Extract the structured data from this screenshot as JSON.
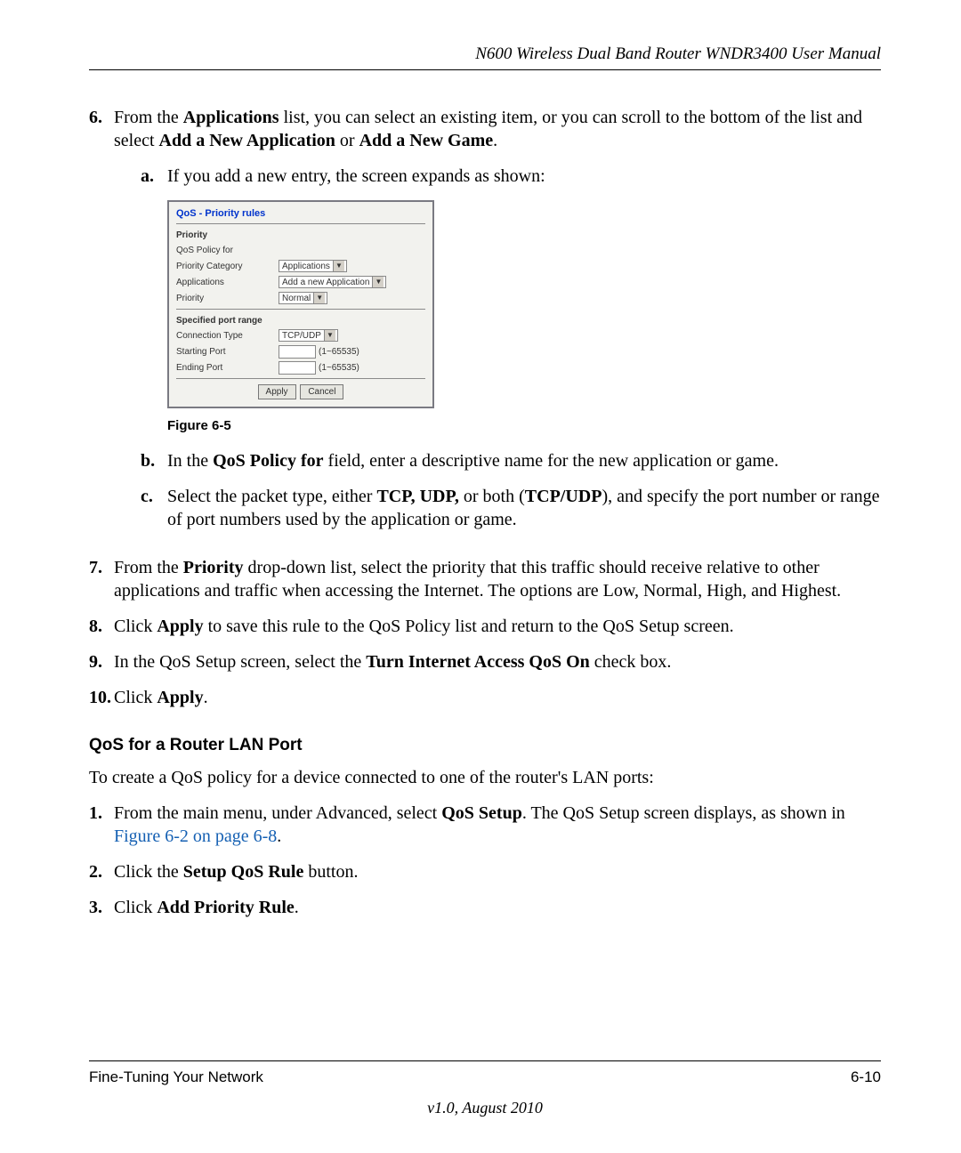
{
  "header": {
    "title": "N600 Wireless Dual Band Router WNDR3400 User Manual"
  },
  "steps": {
    "s6": {
      "num": "6.",
      "t1": "From the ",
      "b1": "Applications",
      "t2": " list, you can select an existing item, or you can scroll to the bottom of the list and select ",
      "b2": "Add a New Application",
      "t3": " or ",
      "b3": "Add a New Game",
      "t4": "."
    },
    "s6a": {
      "num": "a.",
      "text": "If you add a new entry, the screen expands as shown:"
    },
    "s6b": {
      "num": "b.",
      "t1": "In the ",
      "b1": "QoS Policy for",
      "t2": " field, enter a descriptive name for the new application or game."
    },
    "s6c": {
      "num": "c.",
      "t1": "Select the packet type, either ",
      "b1": "TCP, UDP,",
      "t2": " or both (",
      "b2": "TCP/UDP",
      "t3": "), and specify the port number or range of port numbers used by the application or game."
    },
    "s7": {
      "num": "7.",
      "t1": "From the ",
      "b1": "Priority",
      "t2": " drop-down list, select the priority that this traffic should receive relative to other applications and traffic when accessing the Internet. The options are Low, Normal, High, and Highest."
    },
    "s8": {
      "num": "8.",
      "t1": "Click ",
      "b1": "Apply",
      "t2": " to save this rule to the QoS Policy list and return to the QoS Setup screen."
    },
    "s9": {
      "num": "9.",
      "t1": "In the QoS Setup screen, select the ",
      "b1": "Turn Internet Access QoS On",
      "t2": " check box."
    },
    "s10": {
      "num": "10.",
      "t1": "Click ",
      "b1": "Apply",
      "t2": "."
    }
  },
  "figure": {
    "caption": "Figure 6-5",
    "title": "QoS - Priority rules",
    "section1": "Priority",
    "rows1": {
      "policy_for": "QoS Policy for",
      "priority_category": {
        "label": "Priority Category",
        "value": "Applications"
      },
      "applications": {
        "label": "Applications",
        "value": "Add a new Application"
      },
      "priority": {
        "label": "Priority",
        "value": "Normal"
      }
    },
    "section2": "Specified port range",
    "rows2": {
      "conn_type": {
        "label": "Connection Type",
        "value": "TCP/UDP"
      },
      "start": {
        "label": "Starting Port",
        "hint": "(1~65535)"
      },
      "end": {
        "label": "Ending Port",
        "hint": "(1~65535)"
      }
    },
    "buttons": {
      "apply": "Apply",
      "cancel": "Cancel"
    }
  },
  "subheading": "QoS for a Router LAN Port",
  "intro": "To create a QoS policy for a device connected to one of the router's LAN ports:",
  "lan_steps": {
    "l1": {
      "num": "1.",
      "t1": "From the main menu, under Advanced, select ",
      "b1": "QoS Setup",
      "t2": ". The QoS Setup screen displays, as shown in ",
      "link": "Figure 6-2 on page 6-8",
      "t3": "."
    },
    "l2": {
      "num": "2.",
      "t1": "Click the ",
      "b1": "Setup QoS Rule",
      "t2": " button."
    },
    "l3": {
      "num": "3.",
      "t1": "Click ",
      "b1": "Add Priority Rule",
      "t2": "."
    }
  },
  "footer": {
    "left": "Fine-Tuning Your Network",
    "right": "6-10",
    "version": "v1.0, August 2010"
  }
}
